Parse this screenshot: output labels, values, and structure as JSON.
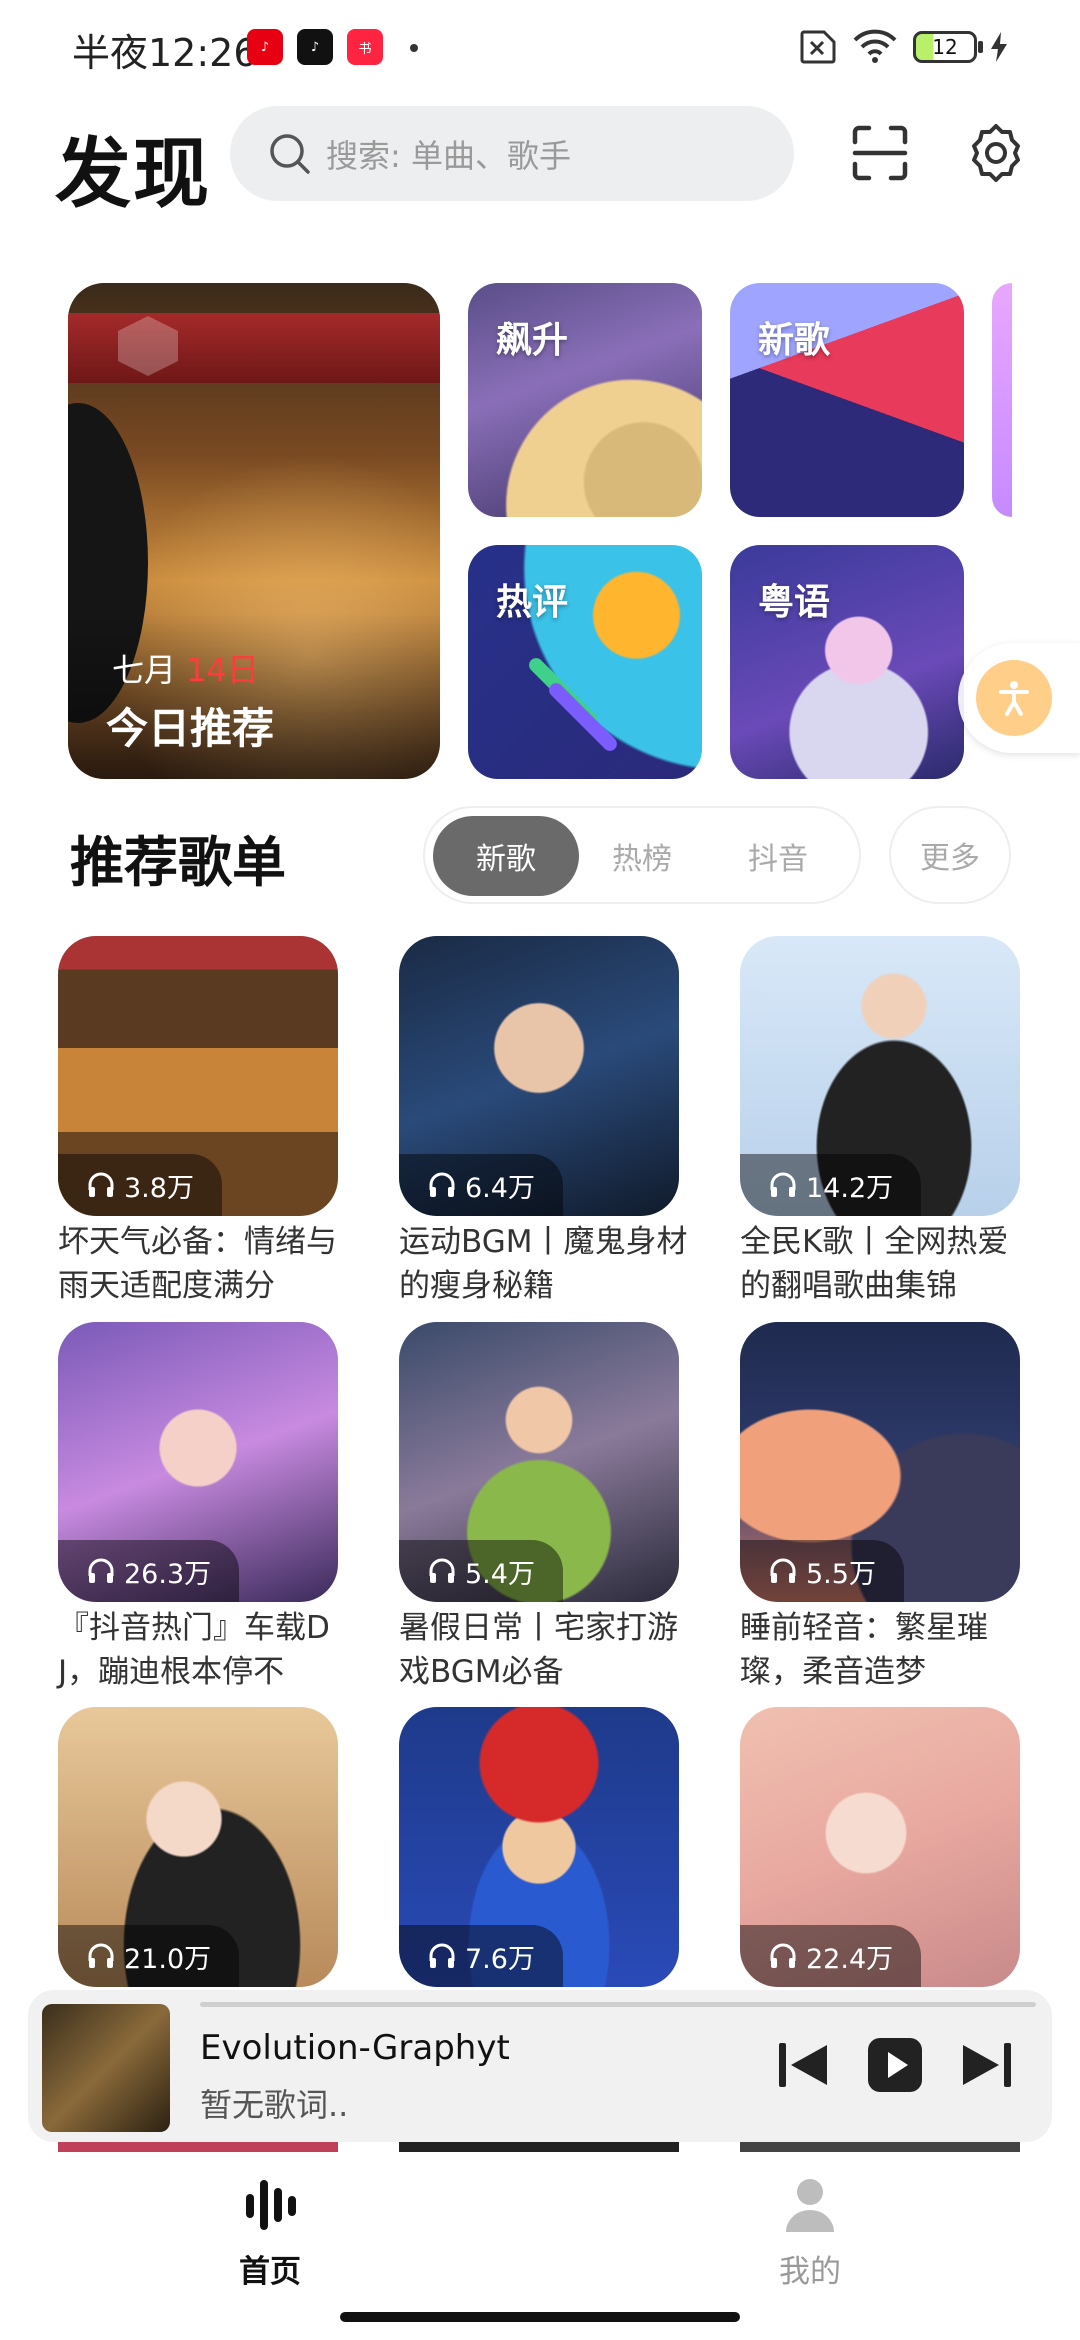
{
  "status_bar": {
    "time": "半夜12:26",
    "battery": "12",
    "app_badges": [
      "netease-music-badge",
      "tiktok-badge",
      "xiaohongshu-badge"
    ],
    "badge_colors": [
      "#e60012",
      "#111111",
      "#ff2442"
    ]
  },
  "header": {
    "title": "发现",
    "search_placeholder": "搜索: 单曲、歌手",
    "scan_icon": "scan-icon",
    "settings_icon": "settings-icon"
  },
  "banners": {
    "big": {
      "month": "七月",
      "day": "14日",
      "title": "今日推荐"
    },
    "tiles": [
      {
        "label": "飙升"
      },
      {
        "label": "新歌"
      },
      {
        "label": "热评"
      },
      {
        "label": "粤语"
      }
    ]
  },
  "section": {
    "title": "推荐歌单",
    "tabs": [
      "新歌",
      "热榜",
      "抖音"
    ],
    "active_tab": "新歌",
    "more_label": "更多"
  },
  "playlists": [
    {
      "count": "3.8万",
      "title": "坏天气必备：情绪与雨天适配度满分"
    },
    {
      "count": "6.4万",
      "title": "运动BGM丨魔鬼身材的瘦身秘籍"
    },
    {
      "count": "14.2万",
      "title": "全民K歌丨全网热爱的翻唱歌曲集锦"
    },
    {
      "count": "26.3万",
      "title": "『抖音热门』车载DJ，蹦迪根本停不"
    },
    {
      "count": "5.4万",
      "title": "暑假日常丨宅家打游戏BGM必备"
    },
    {
      "count": "5.5万",
      "title": "睡前轻音：繁星璀璨，柔音造梦"
    },
    {
      "count": "21.0万",
      "title": ""
    },
    {
      "count": "7.6万",
      "title": ""
    },
    {
      "count": "22.4万",
      "title": ""
    }
  ],
  "mini_player": {
    "song": "Evolution-Graphyt",
    "lyric": "暂无歌词..",
    "progress": 0.0
  },
  "bottom_nav": {
    "items": [
      {
        "label": "首页",
        "icon": "waveform-icon",
        "active": true
      },
      {
        "label": "我的",
        "icon": "person-icon",
        "active": false
      }
    ]
  },
  "colors": {
    "accent_red": "#ff3b3b",
    "segment_active": "#6a6a6a",
    "float_button": "#ffcf8a"
  }
}
